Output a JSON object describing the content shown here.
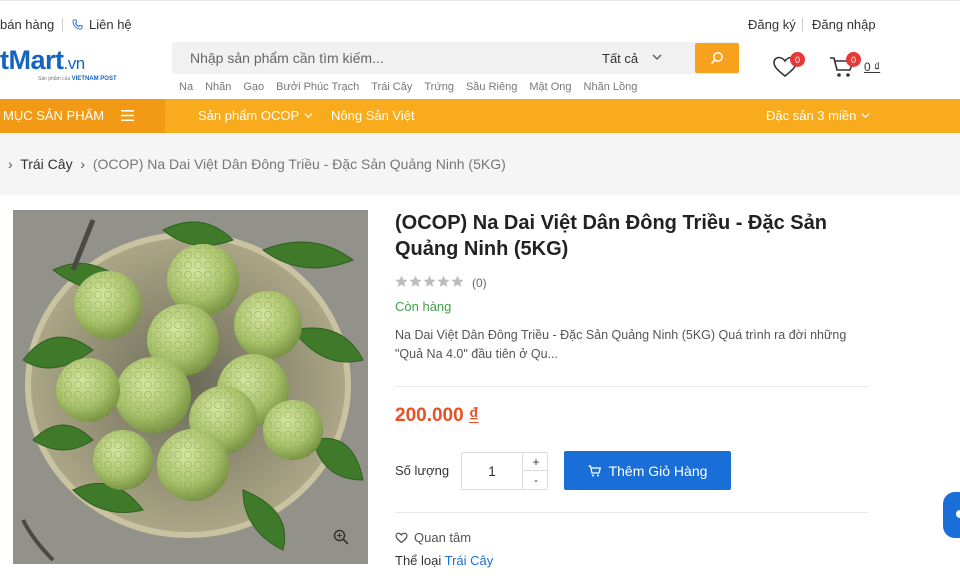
{
  "topbar": {
    "sell_label": "bán hàng",
    "contact_label": "Liên hệ",
    "register_label": "Đăng ký",
    "login_label": "Đăng nhập"
  },
  "header": {
    "logo_text": "tMart",
    "logo_suffix": ".vn",
    "logo_tagline_prefix": "Sản phẩm của",
    "logo_tagline_brand": "VIETNAM POST",
    "search_placeholder": "Nhập sản phẩm cần tìm kiếm...",
    "search_category": "Tất cả",
    "suggestions": [
      "Na",
      "Nhãn",
      "Gạo",
      "Bưởi Phúc Trạch",
      "Trái Cây",
      "Trứng",
      "Sầu Riêng",
      "Mật Ong",
      "Nhãn Lồng"
    ],
    "wishlist_count": "0",
    "cart_count": "0",
    "cart_total": "0 ₫"
  },
  "nav": {
    "categories_label": "MỤC SẢN PHẨM",
    "ocop_label": "Sản phẩm OCOP",
    "agri_label": "Nông Sản Việt",
    "specialty_label": "Đặc sản 3 miền"
  },
  "breadcrumb": {
    "category": "Trái Cây",
    "current": "(OCOP) Na Dai Việt Dân Đông Triều - Đặc Sản Quảng Ninh (5KG)"
  },
  "product": {
    "title": "(OCOP) Na Dai Việt Dân Đông Triều - Đặc Sản Quảng Ninh (5KG)",
    "rating_count": "(0)",
    "rating": 0,
    "stock_status": "Còn hàng",
    "description": "Na Dai Việt Dân Đông Triều - Đặc Sản Quảng Ninh (5KG)      Quá trình ra đời những \"Quả Na 4.0\" đầu tiên ở Qu...",
    "price": "200.000",
    "currency": "₫",
    "quantity_label": "Số lượng",
    "quantity": "1",
    "plus": "+",
    "minus": "-",
    "add_to_cart_label": "Thêm Giỏ Hàng",
    "wishlist_label": "Quan tâm",
    "category_label": "Thể loại",
    "category_value": "Trái Cây"
  },
  "colors": {
    "accent": "#f7ab1d",
    "primary": "#1a6ed8",
    "price": "#e65126",
    "stock": "#43a047"
  }
}
